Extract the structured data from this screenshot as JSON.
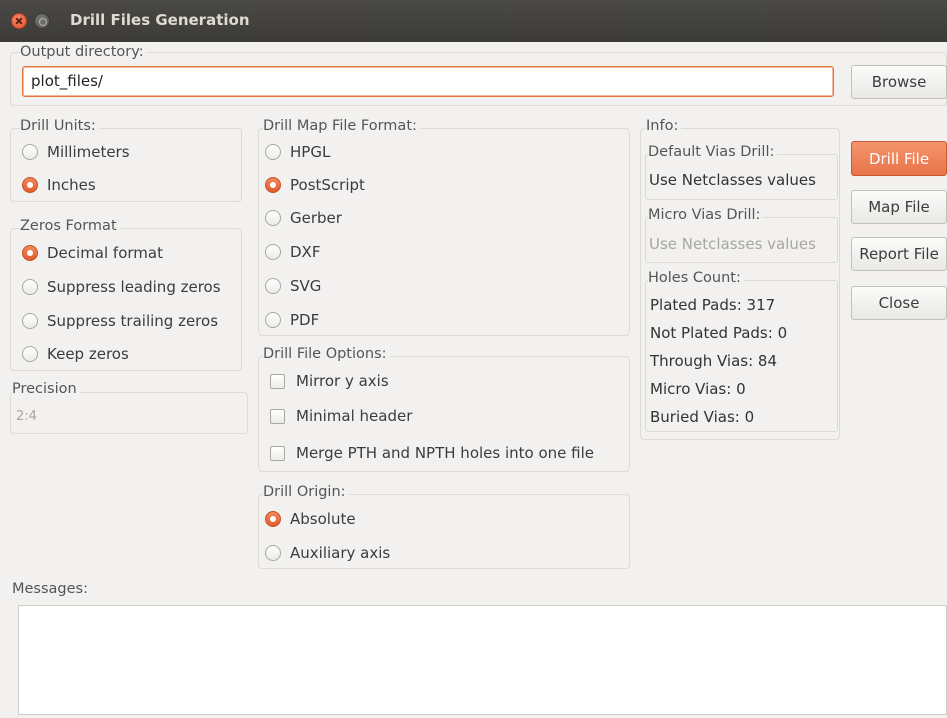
{
  "window": {
    "title": "Drill Files Generation"
  },
  "output": {
    "label": "Output directory:",
    "value": "plot_files/",
    "browse_label": "Browse"
  },
  "drill_units": {
    "label": "Drill Units:",
    "options": [
      {
        "label": "Millimeters",
        "selected": false
      },
      {
        "label": "Inches",
        "selected": true
      }
    ]
  },
  "zeros_format": {
    "label": "Zeros Format",
    "options": [
      {
        "label": "Decimal format",
        "selected": true
      },
      {
        "label": "Suppress leading zeros",
        "selected": false
      },
      {
        "label": "Suppress trailing zeros",
        "selected": false
      },
      {
        "label": "Keep zeros",
        "selected": false
      }
    ]
  },
  "precision": {
    "label": "Precision",
    "value": "2:4"
  },
  "map_format": {
    "label": "Drill Map File Format:",
    "options": [
      {
        "label": "HPGL",
        "selected": false
      },
      {
        "label": "PostScript",
        "selected": true
      },
      {
        "label": "Gerber",
        "selected": false
      },
      {
        "label": "DXF",
        "selected": false
      },
      {
        "label": "SVG",
        "selected": false
      },
      {
        "label": "PDF",
        "selected": false
      }
    ]
  },
  "file_options": {
    "label": "Drill File Options:",
    "options": [
      {
        "label": "Mirror y axis",
        "checked": false
      },
      {
        "label": "Minimal header",
        "checked": false
      },
      {
        "label": "Merge PTH and NPTH holes into one file",
        "checked": false
      }
    ]
  },
  "drill_origin": {
    "label": "Drill Origin:",
    "options": [
      {
        "label": "Absolute",
        "selected": true
      },
      {
        "label": "Auxiliary axis",
        "selected": false
      }
    ]
  },
  "info": {
    "label": "Info:",
    "default_vias_label": "Default Vias Drill:",
    "default_vias_value": "Use Netclasses values",
    "micro_vias_label": "Micro Vias Drill:",
    "micro_vias_value": "Use Netclasses values",
    "holes_label": "Holes Count:",
    "holes": [
      "Plated Pads: 317",
      "Not Plated Pads: 0",
      "Through Vias: 84",
      "Micro Vias: 0",
      "Buried Vias: 0"
    ]
  },
  "actions": {
    "drill_file": "Drill File",
    "map_file": "Map File",
    "report_file": "Report File",
    "close": "Close"
  },
  "messages": {
    "label": "Messages:"
  },
  "colors": {
    "accent": "#e9734a",
    "titlebar": "#3c3b37"
  },
  "icons": {
    "window_close": "close-icon",
    "window_minimize": "minimize-icon"
  }
}
